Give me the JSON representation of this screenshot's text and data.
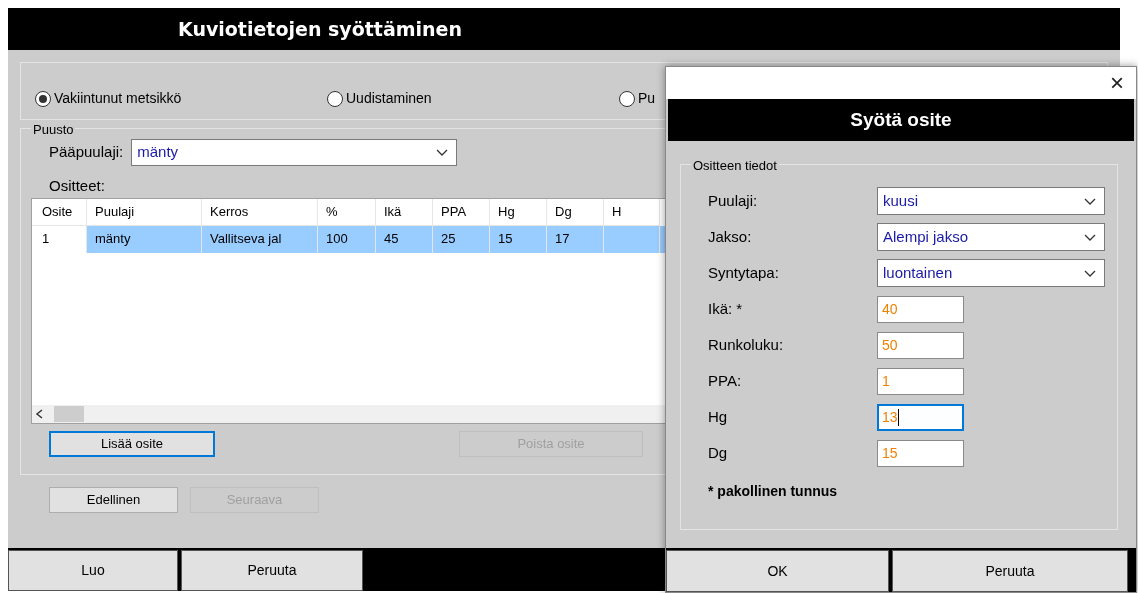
{
  "main_window": {
    "title": "Kuviotietojen syöttäminen",
    "stand_types": [
      {
        "label": "Vakiintunut metsikkö",
        "selected": true
      },
      {
        "label": "Uudistaminen",
        "selected": false
      },
      {
        "label": "Pu",
        "selected": false
      }
    ],
    "puusto": {
      "title": "Puusto",
      "main_species_label": "Pääpuulaji:",
      "main_species_value": "mänty"
    },
    "strata_label": "Ositteet:",
    "table": {
      "columns": [
        "Osite",
        "Puulaji",
        "Kerros",
        "%",
        "Ikä",
        "PPA",
        "Hg",
        "Dg",
        "H"
      ],
      "rows": [
        {
          "cells": [
            "1",
            "mänty",
            "Vallitseva jal",
            "100",
            "45",
            "25",
            "15",
            "17",
            ""
          ],
          "selected": true
        }
      ]
    },
    "strata_buttons": [
      {
        "label": "Lisää osite",
        "disabled": false,
        "focused": true
      },
      {
        "label": "Poista osite",
        "disabled": true,
        "focused": false
      }
    ],
    "nav_buttons": [
      {
        "label": "Edellinen",
        "disabled": false
      },
      {
        "label": "Seuraava",
        "disabled": true
      }
    ],
    "footer_buttons": [
      "Luo",
      "Peruuta"
    ]
  },
  "dialog": {
    "close": "×",
    "title": "Syötä osite",
    "group_title": "Ositteen tiedot",
    "fields": [
      {
        "kind": "select",
        "label": "Puulaji:",
        "value": "kuusi"
      },
      {
        "kind": "select",
        "label": "Jakso:",
        "value": "Alempi jakso"
      },
      {
        "kind": "select",
        "label": "Syntytapa:",
        "value": "luontainen"
      },
      {
        "kind": "text",
        "label": "Ikä: *",
        "value": "40",
        "focused": false
      },
      {
        "kind": "text",
        "label": "Runkoluku:",
        "value": "50",
        "focused": false
      },
      {
        "kind": "text",
        "label": "PPA:",
        "value": "1",
        "focused": false
      },
      {
        "kind": "text",
        "label": "Hg",
        "value": "13",
        "focused": true
      },
      {
        "kind": "text",
        "label": "Dg",
        "value": "15",
        "focused": false
      }
    ],
    "note": "* pakollinen tunnus",
    "buttons": [
      "OK",
      "Peruuta"
    ]
  }
}
